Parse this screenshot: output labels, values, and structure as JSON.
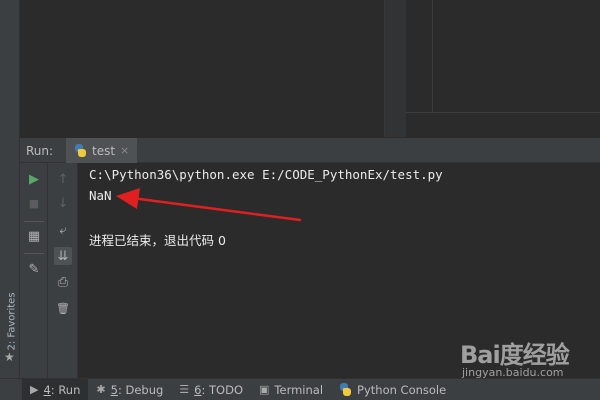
{
  "run_panel": {
    "title": "Run:",
    "tab_name": "test",
    "tab_close": "×"
  },
  "favorites": {
    "label": "2: Favorites"
  },
  "toolbar": {
    "rerun_icon": "▶",
    "stop_icon": "■",
    "layout_icon": "▦",
    "pin_icon": "✎",
    "up_icon": "↑",
    "down_icon": "↓",
    "wrap_icon": "⤶",
    "scroll_end_icon": "⇊",
    "print_icon": "⎙",
    "delete_icon": "🗑"
  },
  "console": {
    "command": "C:\\Python36\\python.exe E:/CODE_PythonEx/test.py",
    "output": "NaN",
    "exit_message": "进程已结束，退出代码 0"
  },
  "bottom_tabs": [
    {
      "icon": "▶",
      "number": "4",
      "label": ": Run",
      "active": true
    },
    {
      "icon": "✱",
      "number": "5",
      "label": ": Debug",
      "active": false
    },
    {
      "icon": "☰",
      "number": "6",
      "label": ": TODO",
      "active": false
    },
    {
      "icon": "▣",
      "number": "",
      "label": "Terminal",
      "active": false
    },
    {
      "icon": "◉",
      "number": "",
      "label": "Python Console",
      "active": false
    }
  ],
  "watermark": {
    "logo": "Bai度经验",
    "url": "jingyan.baidu.com"
  },
  "colors": {
    "background": "#2b2b2b",
    "panel": "#3c3f41",
    "arrow": "#e02020",
    "run_green": "#59a869"
  }
}
